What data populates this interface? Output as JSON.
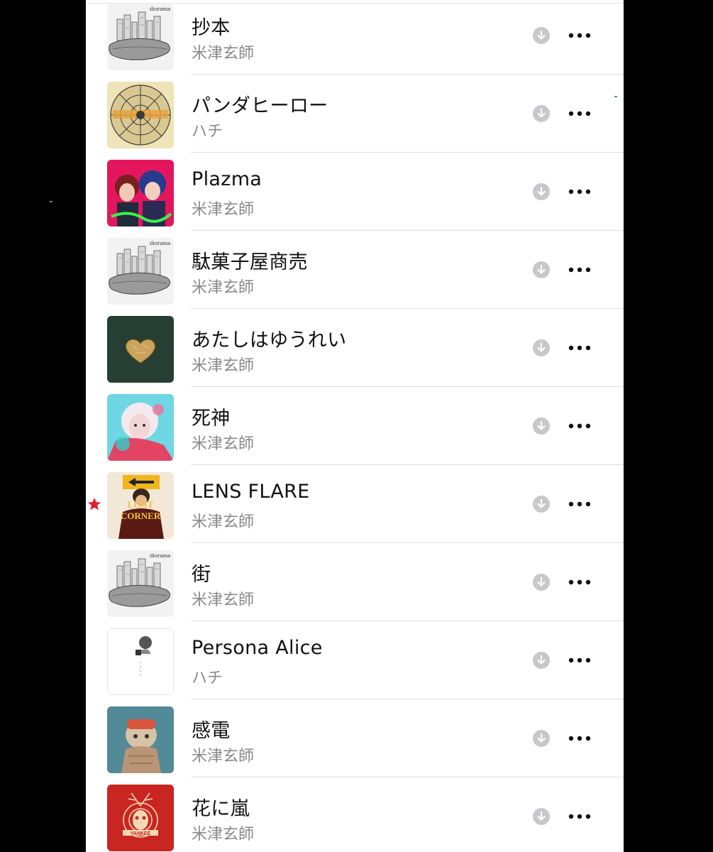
{
  "songs": [
    {
      "title": "抄本",
      "artist": "米津玄師",
      "art": "city-whale-icon"
    },
    {
      "title": "パンダヒーロー",
      "artist": "ハチ",
      "art": "mosaic-circle-icon"
    },
    {
      "title": "Plazma",
      "artist": "米津玄師",
      "art": "anime-duo-icon"
    },
    {
      "title": "駄菓子屋商売",
      "artist": "米津玄師",
      "art": "city-whale-icon"
    },
    {
      "title": "あたしはゆうれい",
      "artist": "米津玄師",
      "art": "gold-heart-icon"
    },
    {
      "title": "死神",
      "artist": "米津玄師",
      "art": "cyan-portrait-icon"
    },
    {
      "title": "LENS FLARE",
      "artist": "米津玄師",
      "art": "lost-corner-icon"
    },
    {
      "title": "街",
      "artist": "米津玄師",
      "art": "city-whale-icon"
    },
    {
      "title": "Persona Alice",
      "artist": "ハチ",
      "art": "tree-sketch-icon"
    },
    {
      "title": "感電",
      "artist": "米津玄師",
      "art": "stray-sheep-icon"
    },
    {
      "title": "花に嵐",
      "artist": "米津玄師",
      "art": "yankee-icon"
    }
  ],
  "colors": {
    "star": "#e8192c",
    "download_icon": "#c7c7cc",
    "more_icon": "#111111",
    "subtitle": "#8a8a8e"
  },
  "icons": {
    "download": "download-circle-icon",
    "more": "more-ellipsis-icon",
    "marker": "star-icon"
  }
}
